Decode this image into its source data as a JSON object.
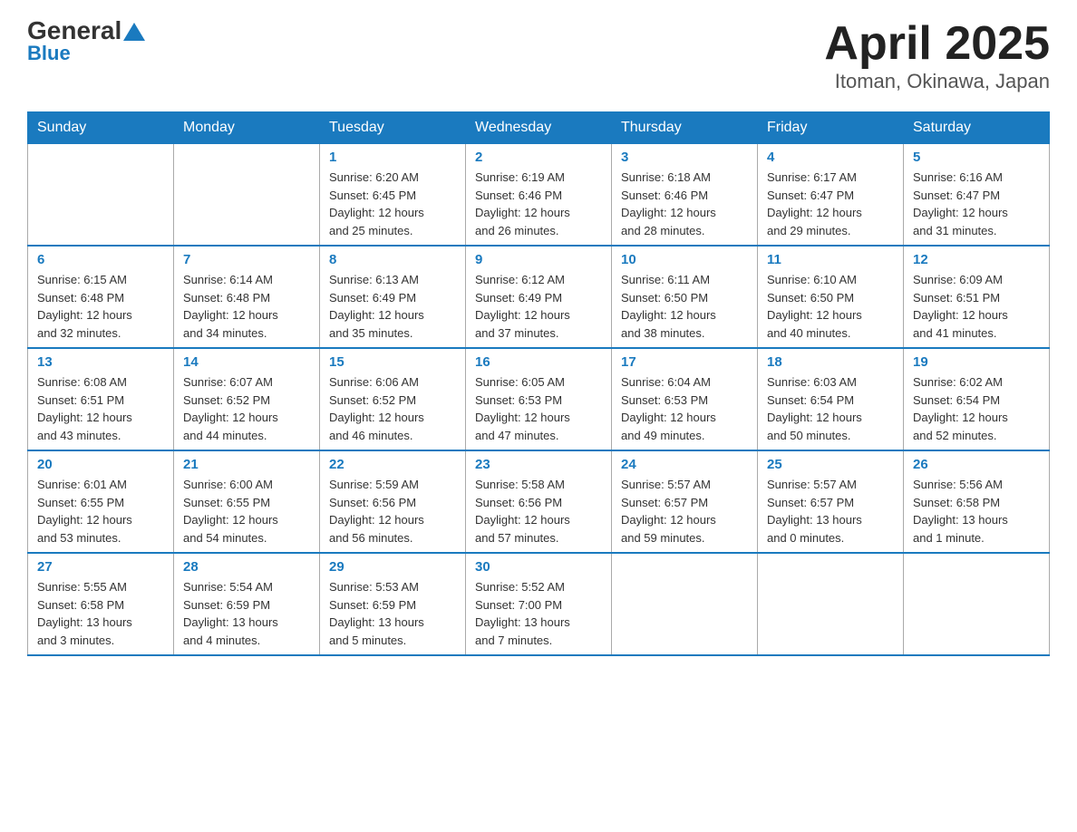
{
  "header": {
    "title": "April 2025",
    "location": "Itoman, Okinawa, Japan",
    "logo_general": "General",
    "logo_blue": "Blue"
  },
  "days_of_week": [
    "Sunday",
    "Monday",
    "Tuesday",
    "Wednesday",
    "Thursday",
    "Friday",
    "Saturday"
  ],
  "weeks": [
    [
      {
        "day": "",
        "info": ""
      },
      {
        "day": "",
        "info": ""
      },
      {
        "day": "1",
        "info": "Sunrise: 6:20 AM\nSunset: 6:45 PM\nDaylight: 12 hours\nand 25 minutes."
      },
      {
        "day": "2",
        "info": "Sunrise: 6:19 AM\nSunset: 6:46 PM\nDaylight: 12 hours\nand 26 minutes."
      },
      {
        "day": "3",
        "info": "Sunrise: 6:18 AM\nSunset: 6:46 PM\nDaylight: 12 hours\nand 28 minutes."
      },
      {
        "day": "4",
        "info": "Sunrise: 6:17 AM\nSunset: 6:47 PM\nDaylight: 12 hours\nand 29 minutes."
      },
      {
        "day": "5",
        "info": "Sunrise: 6:16 AM\nSunset: 6:47 PM\nDaylight: 12 hours\nand 31 minutes."
      }
    ],
    [
      {
        "day": "6",
        "info": "Sunrise: 6:15 AM\nSunset: 6:48 PM\nDaylight: 12 hours\nand 32 minutes."
      },
      {
        "day": "7",
        "info": "Sunrise: 6:14 AM\nSunset: 6:48 PM\nDaylight: 12 hours\nand 34 minutes."
      },
      {
        "day": "8",
        "info": "Sunrise: 6:13 AM\nSunset: 6:49 PM\nDaylight: 12 hours\nand 35 minutes."
      },
      {
        "day": "9",
        "info": "Sunrise: 6:12 AM\nSunset: 6:49 PM\nDaylight: 12 hours\nand 37 minutes."
      },
      {
        "day": "10",
        "info": "Sunrise: 6:11 AM\nSunset: 6:50 PM\nDaylight: 12 hours\nand 38 minutes."
      },
      {
        "day": "11",
        "info": "Sunrise: 6:10 AM\nSunset: 6:50 PM\nDaylight: 12 hours\nand 40 minutes."
      },
      {
        "day": "12",
        "info": "Sunrise: 6:09 AM\nSunset: 6:51 PM\nDaylight: 12 hours\nand 41 minutes."
      }
    ],
    [
      {
        "day": "13",
        "info": "Sunrise: 6:08 AM\nSunset: 6:51 PM\nDaylight: 12 hours\nand 43 minutes."
      },
      {
        "day": "14",
        "info": "Sunrise: 6:07 AM\nSunset: 6:52 PM\nDaylight: 12 hours\nand 44 minutes."
      },
      {
        "day": "15",
        "info": "Sunrise: 6:06 AM\nSunset: 6:52 PM\nDaylight: 12 hours\nand 46 minutes."
      },
      {
        "day": "16",
        "info": "Sunrise: 6:05 AM\nSunset: 6:53 PM\nDaylight: 12 hours\nand 47 minutes."
      },
      {
        "day": "17",
        "info": "Sunrise: 6:04 AM\nSunset: 6:53 PM\nDaylight: 12 hours\nand 49 minutes."
      },
      {
        "day": "18",
        "info": "Sunrise: 6:03 AM\nSunset: 6:54 PM\nDaylight: 12 hours\nand 50 minutes."
      },
      {
        "day": "19",
        "info": "Sunrise: 6:02 AM\nSunset: 6:54 PM\nDaylight: 12 hours\nand 52 minutes."
      }
    ],
    [
      {
        "day": "20",
        "info": "Sunrise: 6:01 AM\nSunset: 6:55 PM\nDaylight: 12 hours\nand 53 minutes."
      },
      {
        "day": "21",
        "info": "Sunrise: 6:00 AM\nSunset: 6:55 PM\nDaylight: 12 hours\nand 54 minutes."
      },
      {
        "day": "22",
        "info": "Sunrise: 5:59 AM\nSunset: 6:56 PM\nDaylight: 12 hours\nand 56 minutes."
      },
      {
        "day": "23",
        "info": "Sunrise: 5:58 AM\nSunset: 6:56 PM\nDaylight: 12 hours\nand 57 minutes."
      },
      {
        "day": "24",
        "info": "Sunrise: 5:57 AM\nSunset: 6:57 PM\nDaylight: 12 hours\nand 59 minutes."
      },
      {
        "day": "25",
        "info": "Sunrise: 5:57 AM\nSunset: 6:57 PM\nDaylight: 13 hours\nand 0 minutes."
      },
      {
        "day": "26",
        "info": "Sunrise: 5:56 AM\nSunset: 6:58 PM\nDaylight: 13 hours\nand 1 minute."
      }
    ],
    [
      {
        "day": "27",
        "info": "Sunrise: 5:55 AM\nSunset: 6:58 PM\nDaylight: 13 hours\nand 3 minutes."
      },
      {
        "day": "28",
        "info": "Sunrise: 5:54 AM\nSunset: 6:59 PM\nDaylight: 13 hours\nand 4 minutes."
      },
      {
        "day": "29",
        "info": "Sunrise: 5:53 AM\nSunset: 6:59 PM\nDaylight: 13 hours\nand 5 minutes."
      },
      {
        "day": "30",
        "info": "Sunrise: 5:52 AM\nSunset: 7:00 PM\nDaylight: 13 hours\nand 7 minutes."
      },
      {
        "day": "",
        "info": ""
      },
      {
        "day": "",
        "info": ""
      },
      {
        "day": "",
        "info": ""
      }
    ]
  ]
}
